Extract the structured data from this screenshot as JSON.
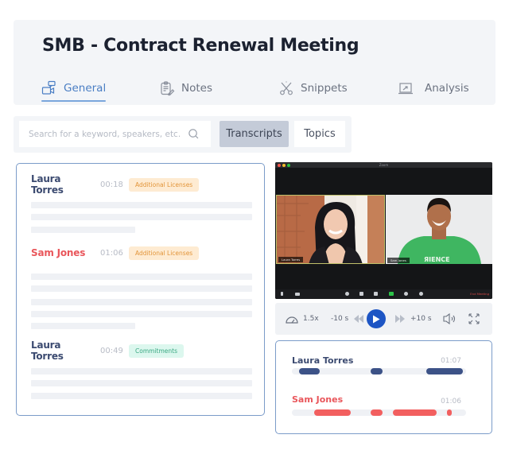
{
  "header": {
    "title": "SMB - Contract Renewal Meeting",
    "tabs": [
      {
        "label": "General",
        "icon": "video-chat-icon",
        "active": true
      },
      {
        "label": "Notes",
        "icon": "clipboard-edit-icon",
        "active": false
      },
      {
        "label": "Snippets",
        "icon": "scissors-icon",
        "active": false
      },
      {
        "label": "Analysis",
        "icon": "chart-board-icon",
        "active": false
      }
    ]
  },
  "search": {
    "placeholder": "Search for a keyword, speakers, etc.",
    "value": "",
    "icon": "search-icon"
  },
  "view_toggle": {
    "options": [
      {
        "label": "Transcripts",
        "active": true
      },
      {
        "label": "Topics",
        "active": false
      }
    ]
  },
  "transcript": {
    "entries": [
      {
        "speaker": "Laura Torres",
        "time": "00:18",
        "tag": "Additional Licenses",
        "tag_color": "orange",
        "lines": 3
      },
      {
        "speaker": "Sam Jones",
        "time": "01:06",
        "tag": "Additional Licenses",
        "tag_color": "orange",
        "lines": 5
      },
      {
        "speaker": "Laura Torres",
        "time": "00:49",
        "tag": "Commitments",
        "tag_color": "green",
        "lines": 3
      }
    ]
  },
  "video": {
    "window_title": "Zoom",
    "participants": [
      {
        "name": "Laura Torres"
      },
      {
        "name": "Sam Jones"
      }
    ],
    "end_label": "End Meeting"
  },
  "player": {
    "speed": "1.5x",
    "rewind_label": "-10 s",
    "forward_label": "+10 s",
    "icons": [
      "speedometer-icon",
      "rewind-icon",
      "play-icon",
      "fast-forward-icon",
      "volume-icon",
      "fullscreen-icon"
    ]
  },
  "speakers": {
    "items": [
      {
        "name": "Laura Torres",
        "duration": "01:07",
        "color": "#3c5287",
        "segments": [
          [
            0.04,
            0.16
          ],
          [
            0.45,
            0.52
          ],
          [
            0.77,
            0.98
          ]
        ]
      },
      {
        "name": "Sam Jones",
        "duration": "01:06",
        "color": "#f25f5f",
        "segments": [
          [
            0.13,
            0.34
          ],
          [
            0.45,
            0.52
          ],
          [
            0.58,
            0.83
          ],
          [
            0.89,
            0.92
          ]
        ]
      }
    ]
  },
  "colors": {
    "accent": "#4a7ec4",
    "play_button": "#1d55c4",
    "laura": "#3b4a70",
    "sam": "#e9565b"
  }
}
